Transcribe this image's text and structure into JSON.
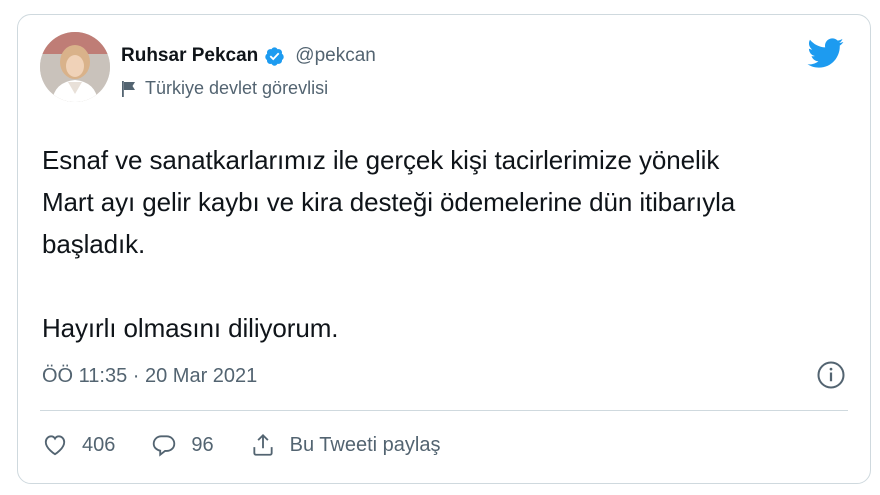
{
  "user": {
    "display_name": "Ruhsar Pekcan",
    "handle": "@pekcan",
    "label": "Türkiye devlet görevlisi",
    "verified": true
  },
  "tweet": {
    "text_lines": [
      "Esnaf ve sanatkarlarımız ile gerçek kişi tacirlerimize yönelik",
      "Mart ayı gelir kaybı ve kira desteği ödemelerine dün itibarıyla",
      "başladık."
    ],
    "text_second": "Hayırlı olmasını diliyorum.",
    "timestamp": "ÖÖ 11:35 · 20 Mar 2021"
  },
  "actions": {
    "likes": "406",
    "replies": "96",
    "share_label": "Bu Tweeti paylaş"
  },
  "icons": {
    "verified": "verified-badge-icon",
    "flag": "flag-icon",
    "twitter": "twitter-bird-icon",
    "info": "info-icon",
    "like": "heart-icon",
    "reply": "reply-bubble-icon",
    "share": "share-icon"
  },
  "colors": {
    "accent": "#1d9bf0",
    "text": "#0f1419",
    "secondary": "#536471",
    "border": "#cfd9de"
  }
}
